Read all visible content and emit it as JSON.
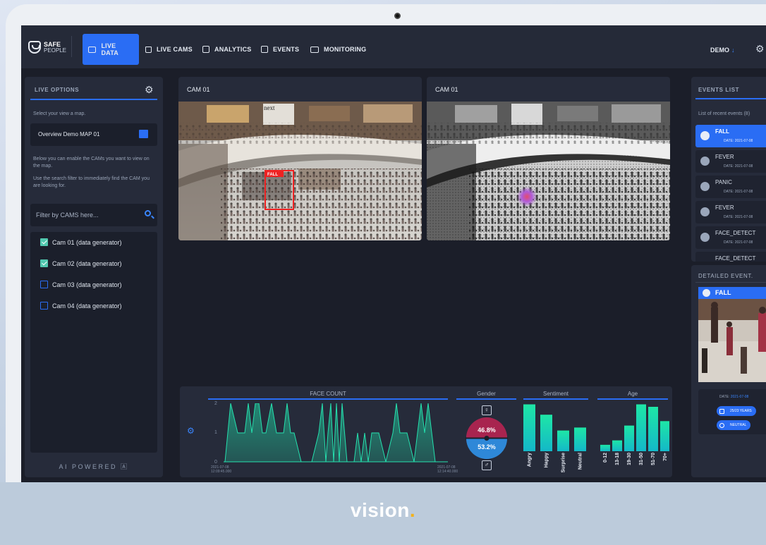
{
  "app": {
    "name": "SAFE",
    "name_sub": "PEOPLE"
  },
  "nav": {
    "items": [
      {
        "label": "LIVE DATA",
        "icon": "screen-icon",
        "active": true
      },
      {
        "label": "LIVE CAMS",
        "icon": "home-icon",
        "active": false
      },
      {
        "label": "ANALYTICS",
        "icon": "chart-icon",
        "active": false
      },
      {
        "label": "EVENTS",
        "icon": "calendar-icon",
        "active": false
      },
      {
        "label": "MONITORING",
        "icon": "monitor-icon",
        "active": false
      }
    ],
    "user": "DEMO"
  },
  "live_options": {
    "title": "LIVE OPTIONS",
    "select_text": "Select your view a map.",
    "map_selected": "Overview Demo MAP 01",
    "enable_text": "Below you can enable the CAMs you want to view on the map.",
    "search_text": "Use the search filter to immediately find the CAM you are looking for.",
    "filter_placeholder": "Filter by CAMS here...",
    "cams": [
      {
        "label": "Cam 01 (data generator)",
        "checked": true
      },
      {
        "label": "Cam 02 (data generator)",
        "checked": true
      },
      {
        "label": "Cam 03 (data generator)",
        "checked": false
      },
      {
        "label": "Cam 04 (data generator)",
        "checked": false
      }
    ],
    "powered": "AI POWERED"
  },
  "cams": [
    {
      "title": "CAM 01",
      "overlay_label": "FALL",
      "store_sign": "next"
    },
    {
      "title": "CAM 01"
    }
  ],
  "analytics": {
    "face_count": {
      "title": "FACE COUNT",
      "y_ticks": [
        "2",
        "1",
        "0"
      ],
      "start_label": [
        "2021-07-08",
        "12:09:45.000"
      ],
      "end_label": [
        "2021-07-08",
        "12:14:40.000"
      ]
    },
    "gender": {
      "title": "Gender",
      "female_pct": "46.8%",
      "male_pct": "53.2%",
      "female_value": 46.8,
      "male_value": 53.2
    },
    "sentiment": {
      "title": "Sentiment",
      "labels": [
        "Angry",
        "Happy",
        "Surprise",
        "Neutral"
      ],
      "values": [
        0.95,
        0.74,
        0.42,
        0.48
      ]
    },
    "age": {
      "title": "Age",
      "labels": [
        "0-12",
        "13-18",
        "19-30",
        "31-50",
        "51-70",
        "70+"
      ],
      "values": [
        0.13,
        0.22,
        0.52,
        0.95,
        0.9,
        0.61
      ]
    }
  },
  "events_list": {
    "title": "EVENTS LIST",
    "subtitle": "List of recent events (8)",
    "date_prefix": "DATE:",
    "events": [
      {
        "name": "FALL",
        "date": "2021-07-08",
        "selected": true
      },
      {
        "name": "FEVER",
        "date": "2021-07-08",
        "selected": false
      },
      {
        "name": "PANIC",
        "date": "2021-07-08",
        "selected": false
      },
      {
        "name": "FEVER",
        "date": "2021-07-08",
        "selected": false
      },
      {
        "name": "FACE_DETECT",
        "date": "2021-07-08",
        "selected": false
      },
      {
        "name": "FACE_DETECT",
        "date": "",
        "selected": false
      }
    ]
  },
  "detailed_event": {
    "title": "DETAILED EVENT.",
    "event_name": "FALL",
    "date_prefix": "DATE:",
    "date": "2021-07-08",
    "age_pill": "25/23 YEARS",
    "sentiment_pill": "NEUTRAL"
  },
  "branding": {
    "word": "vision",
    "dot": "."
  }
}
